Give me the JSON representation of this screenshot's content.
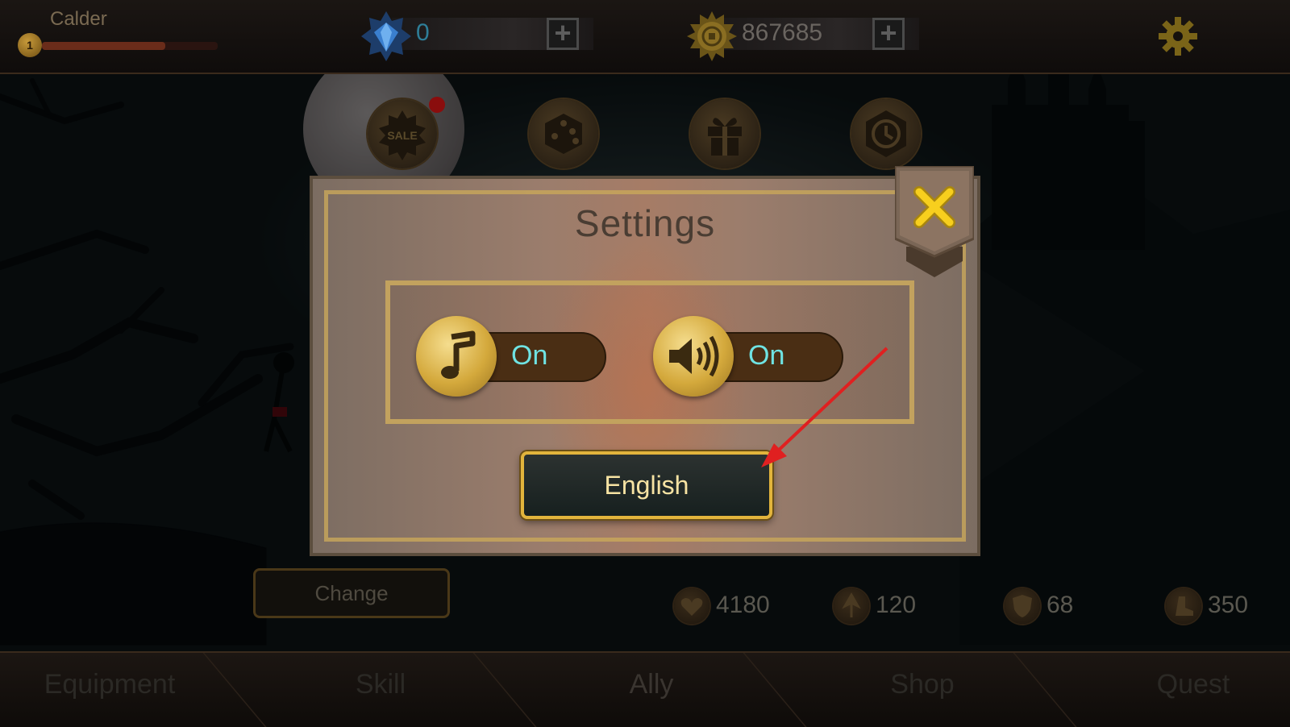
{
  "player": {
    "name": "Calder",
    "level": "1",
    "xp_fraction": 0.7
  },
  "currencies": {
    "gems": {
      "icon": "diamond-icon",
      "amount": "0"
    },
    "gold": {
      "icon": "gold-coin-icon",
      "amount": "867685"
    }
  },
  "topbar_icons": [
    "plus-icon",
    "plus-icon",
    "gear-icon"
  ],
  "feature_icons": [
    "sale-icon",
    "dice-icon",
    "gift-icon",
    "clock-icon"
  ],
  "settings": {
    "title": "Settings",
    "music": {
      "icon": "music-note-icon",
      "state": "On"
    },
    "sound": {
      "icon": "speaker-icon",
      "state": "On"
    },
    "language_label": "English",
    "close_icon": "close-icon"
  },
  "change_label": "Change",
  "stats": [
    {
      "icon": "heart-icon",
      "value": "4180"
    },
    {
      "icon": "attack-icon",
      "value": "120"
    },
    {
      "icon": "shield-icon",
      "value": "68"
    },
    {
      "icon": "boot-icon",
      "value": "350"
    }
  ],
  "nav": {
    "tabs": [
      "Equipment",
      "Skill",
      "Ally",
      "Shop",
      "Quest"
    ],
    "active": "Ally"
  },
  "colors": {
    "accent_gold": "#e2b43c",
    "toggle_on_text": "#6fe3e3",
    "annotation_arrow": "#e02020"
  }
}
